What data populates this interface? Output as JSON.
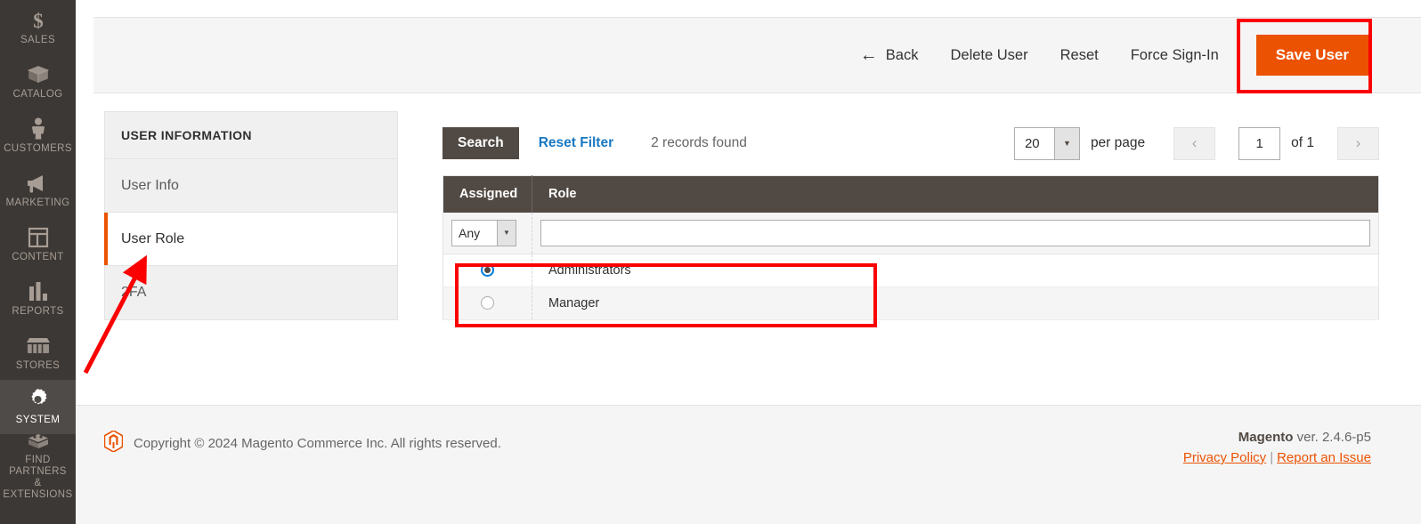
{
  "sidebar": {
    "items": [
      {
        "label": "SALES",
        "icon": "dollar-icon",
        "active": false
      },
      {
        "label": "CATALOG",
        "icon": "box-icon",
        "active": false
      },
      {
        "label": "CUSTOMERS",
        "icon": "person-icon",
        "active": false
      },
      {
        "label": "MARKETING",
        "icon": "megaphone-icon",
        "active": false
      },
      {
        "label": "CONTENT",
        "icon": "layout-icon",
        "active": false
      },
      {
        "label": "REPORTS",
        "icon": "bar-chart-icon",
        "active": false
      },
      {
        "label": "STORES",
        "icon": "store-icon",
        "active": false
      },
      {
        "label": "SYSTEM",
        "icon": "gear-icon",
        "active": true
      },
      {
        "label": "FIND PARTNERS\n& EXTENSIONS",
        "icon": "bricks-icon",
        "active": false
      }
    ]
  },
  "page_actions": {
    "back_label": "Back",
    "back_icon": "arrow-left-icon",
    "delete_user_label": "Delete User",
    "reset_label": "Reset",
    "force_signin_label": "Force Sign-In",
    "save_user_label": "Save User",
    "save_user_color": "#eb5202"
  },
  "tab_panel": {
    "title": "USER INFORMATION",
    "items": [
      {
        "label": "User Info",
        "active": false
      },
      {
        "label": "User Role",
        "active": true
      },
      {
        "label": "2FA",
        "active": false
      }
    ],
    "active_marker_color": "#eb5202"
  },
  "grid_toolbar": {
    "search_label": "Search",
    "reset_filter_label": "Reset Filter",
    "records_found": "2 records found",
    "per_page_value": "20",
    "per_page_label": "per page",
    "prev_icon": "chevron-left-icon",
    "next_icon": "chevron-right-icon",
    "page_value": "1",
    "of_pages": "of 1"
  },
  "table": {
    "columns": [
      "Assigned",
      "Role"
    ],
    "filter": {
      "assigned_value": "Any",
      "role_value": "",
      "role_placeholder": ""
    },
    "rows": [
      {
        "assigned": true,
        "role": "Administrators"
      },
      {
        "assigned": false,
        "role": "Manager"
      }
    ]
  },
  "footer": {
    "logo_icon": "magento-logo-icon",
    "copyright": "Copyright © 2024 Magento Commerce Inc. All rights reserved.",
    "brand": "Magento",
    "version": " ver. 2.4.6-p5",
    "privacy_policy": "Privacy Policy",
    "separator": "|",
    "report_issue": "Report an Issue",
    "link_color": "#eb5202"
  },
  "annotations": {
    "box_color": "#fa0000",
    "save_user_highlight": true,
    "role_rows_highlight": true,
    "arrow_points_to": "User Role"
  }
}
